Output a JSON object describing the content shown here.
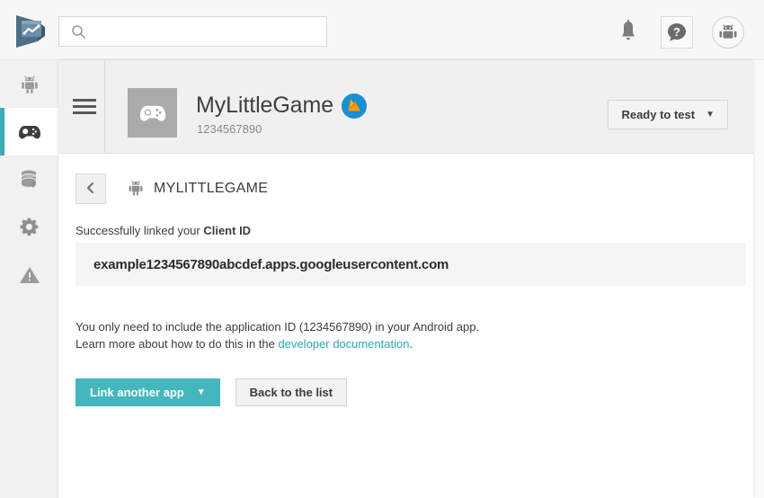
{
  "topbar": {
    "logo_icon": "play-console-logo-icon",
    "search": {
      "icon": "search-icon",
      "value": "",
      "placeholder": ""
    },
    "actions": [
      {
        "icon": "bell-icon",
        "name": "notifications-button"
      },
      {
        "icon": "help-icon",
        "name": "help-button",
        "glyph": "?"
      },
      {
        "icon": "android-avatar-icon",
        "name": "account-avatar-button"
      }
    ]
  },
  "sidebar": {
    "items": [
      {
        "icon": "android-icon",
        "name": "sidebar-item-android",
        "active": false
      },
      {
        "icon": "gamepad-icon",
        "name": "sidebar-item-games",
        "active": true
      },
      {
        "icon": "database-icon",
        "name": "sidebar-item-storage",
        "active": false
      },
      {
        "icon": "gear-icon",
        "name": "sidebar-item-settings",
        "active": false
      },
      {
        "icon": "warning-icon",
        "name": "sidebar-item-alerts",
        "active": false
      }
    ],
    "accent_color": "#3aafbb"
  },
  "app_header": {
    "menu_icon": "hamburger-icon",
    "app_icon": "gamepad-icon",
    "title": "MyLittleGame",
    "badge_icon": "firebase-icon",
    "app_id": "1234567890",
    "status_button": {
      "label": "Ready to test",
      "caret": "▼"
    }
  },
  "content": {
    "back_button_icon": "chevron-left-icon",
    "breadcrumb_icon": "android-icon",
    "breadcrumb_label": "MYLITTLEGAME",
    "linked_prefix": "Successfully linked your ",
    "linked_strong": "Client ID",
    "client_id": "example1234567890abcdef.apps.googleusercontent.com",
    "description_line1": "You only need to include the application ID (1234567890) in your Android app.",
    "description_line2_prefix": "Learn more about how to do this in the ",
    "description_link": "developer documentation",
    "description_line2_suffix": ".",
    "primary_button": {
      "label": "Link another app",
      "caret": "▼"
    },
    "secondary_button": {
      "label": "Back to the list"
    }
  },
  "colors": {
    "accent_teal": "#45b6be",
    "link_teal": "#2ba6bb",
    "firebase_blue": "#1a8fd1",
    "firebase_orange": "#f5820d"
  }
}
